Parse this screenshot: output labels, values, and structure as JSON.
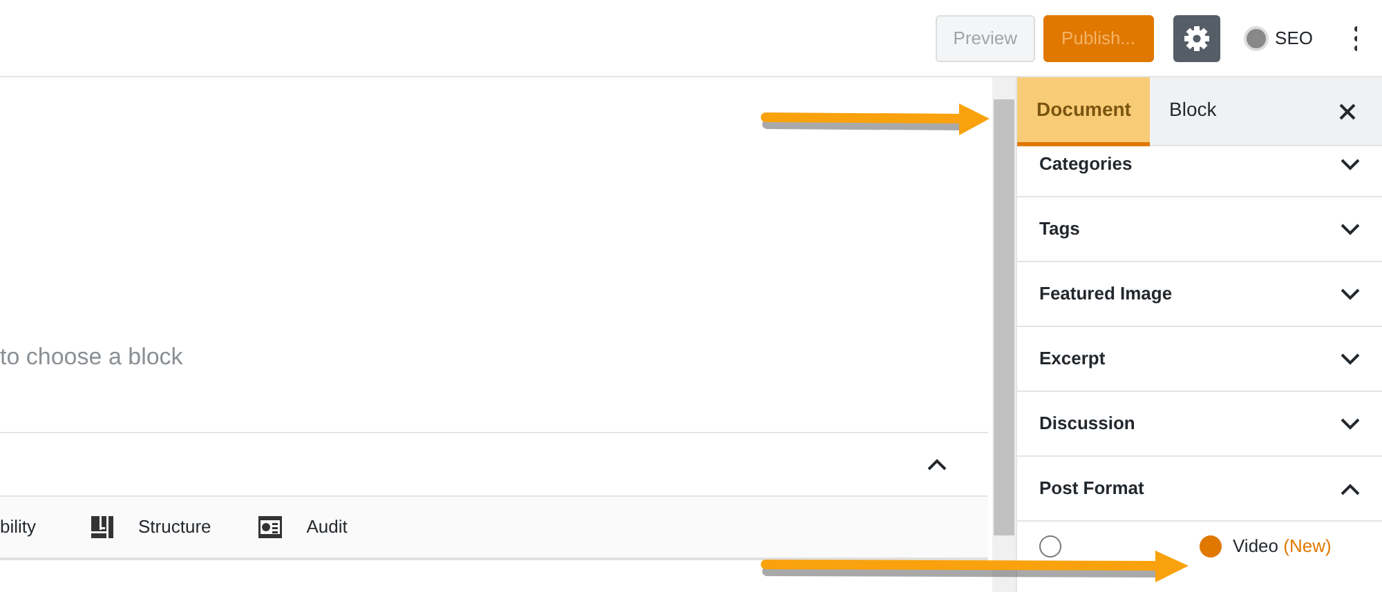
{
  "toolbar": {
    "buttons": [
      {
        "label": "Preview",
        "kind": "secondary",
        "disabled": true
      },
      {
        "label": "Publish...",
        "kind": "primary",
        "disabled": true
      }
    ],
    "settings": {
      "pressed": true
    },
    "seo": {
      "label": "SEO"
    }
  },
  "editor": {
    "hint": "to choose a block"
  },
  "bottom_panel": {
    "expanded": true,
    "tabs": [
      {
        "label": "bility"
      },
      {
        "label": "Structure"
      },
      {
        "label": "Audit"
      }
    ]
  },
  "sidebar": {
    "tabs": [
      {
        "label": "Document",
        "selected": true
      },
      {
        "label": "Block",
        "selected": false
      }
    ],
    "sections": [
      {
        "title": "Categories",
        "expanded": false
      },
      {
        "title": "Tags",
        "expanded": false
      },
      {
        "title": "Featured Image",
        "expanded": false
      },
      {
        "title": "Excerpt",
        "expanded": false
      },
      {
        "title": "Discussion",
        "expanded": false
      },
      {
        "title": "Post Format",
        "expanded": true
      }
    ],
    "post_format": {
      "options": [
        {
          "selected": false
        },
        {
          "label": "Video",
          "badge": "(New)",
          "selected": true
        }
      ]
    }
  }
}
